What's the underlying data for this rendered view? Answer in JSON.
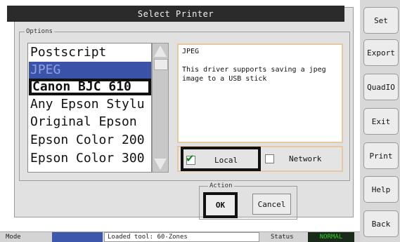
{
  "dialog": {
    "title": "Select Printer",
    "options_legend": "Options",
    "action_legend": "Action"
  },
  "printer_list": {
    "items": [
      {
        "label": "Postscript"
      },
      {
        "label": "JPEG"
      },
      {
        "label": "Canon BJC 610"
      },
      {
        "label": "Any Epson Stylu"
      },
      {
        "label": "Original Epson"
      },
      {
        "label": "Epson Color 200"
      },
      {
        "label": "Epson Color 300"
      }
    ],
    "selected": "JPEG"
  },
  "description": {
    "title": "JPEG",
    "text": "This driver supports saving a jpeg image to a USB stick"
  },
  "connection": {
    "local_label": "Local",
    "local_checked": true,
    "network_label": "Network",
    "network_checked": false
  },
  "actions": {
    "ok_label": "OK",
    "cancel_label": "Cancel"
  },
  "side_buttons": [
    "Set",
    "Export",
    "QuadIO",
    "Exit",
    "Print",
    "Help",
    "Back"
  ],
  "status_bar": {
    "mode_label": "Mode",
    "message": "Loaded tool: 60-Zones",
    "status_label": "Status",
    "status_value": "NORMAL",
    "status_color": "#2bd21f"
  }
}
